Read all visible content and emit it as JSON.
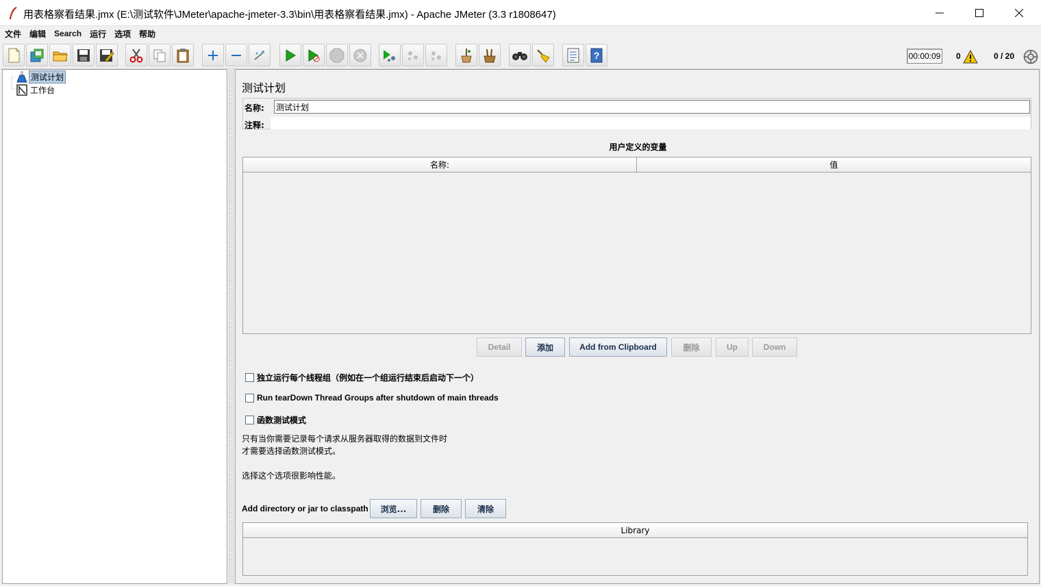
{
  "window": {
    "title": "用表格察看结果.jmx (E:\\测试软件\\JMeter\\apache-jmeter-3.3\\bin\\用表格察看结果.jmx) - Apache JMeter (3.3 r1808647)"
  },
  "menu": {
    "items": [
      "文件",
      "编辑",
      "Search",
      "运行",
      "选项",
      "帮助"
    ]
  },
  "status": {
    "timer": "00:00:09",
    "error_count": "0",
    "threads": "0 / 20"
  },
  "tree": {
    "nodes": [
      {
        "label": "测试计划",
        "selected": true
      },
      {
        "label": "工作台",
        "selected": false
      }
    ]
  },
  "panel": {
    "title": "测试计划",
    "name_label": "名称:",
    "name_value": "测试计划",
    "comment_label": "注释:",
    "comment_value": "",
    "vars_title": "用户定义的变量",
    "vars_columns": [
      "名称:",
      "值"
    ],
    "buttons": {
      "detail": "Detail",
      "add": "添加",
      "add_clipboard": "Add from Clipboard",
      "delete": "删除",
      "up": "Up",
      "down": "Down"
    },
    "checkboxes": [
      {
        "label": "独立运行每个线程组（例如在一个组运行结束后启动下一个）",
        "checked": false
      },
      {
        "label": "Run tearDown Thread Groups after shutdown of main threads",
        "checked": false
      },
      {
        "label": "函数测试模式",
        "checked": false
      }
    ],
    "notes": [
      "只有当你需要记录每个请求从服务器取得的数据到文件时",
      "才需要选择函数测试模式。",
      "选择这个选项很影响性能。"
    ],
    "classpath_label": "Add directory or jar to classpath",
    "classpath_buttons": {
      "browse": "浏览...",
      "delete": "删除",
      "clear": "清除"
    },
    "library_column": "Library"
  },
  "colors": {
    "accent": "#1b2f4a",
    "selection": "#b8cfe5",
    "run_green": "#1aa51a",
    "warning": "#f5c400"
  }
}
